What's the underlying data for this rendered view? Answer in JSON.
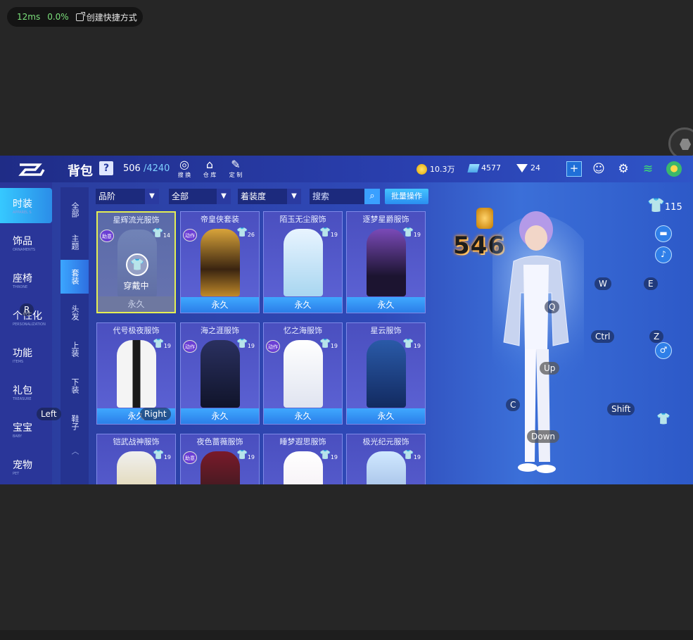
{
  "perf": {
    "latency": "12ms",
    "loss": "0.0%",
    "shortcut": "创建快捷方式"
  },
  "header": {
    "title": "背包",
    "help": "?",
    "capacity_used": "506",
    "capacity_max": "/4240",
    "icons": [
      {
        "label": "搜 换",
        "icon": "search-swap-icon"
      },
      {
        "label": "仓 库",
        "icon": "warehouse-icon"
      },
      {
        "label": "定 制",
        "icon": "custom-icon"
      }
    ],
    "coins": "10.3万",
    "tickets": "4577",
    "diamonds": "24"
  },
  "leftnav": [
    {
      "cn": "时装",
      "en": "APPAREL S"
    },
    {
      "cn": "饰品",
      "en": "ORNAMENTS"
    },
    {
      "cn": "座椅",
      "en": "THRONE"
    },
    {
      "cn": "个性化",
      "en": "PERSONALIZATION"
    },
    {
      "cn": "功能",
      "en": "ITEMS"
    },
    {
      "cn": "礼包",
      "en": "TREASURE"
    },
    {
      "cn": "宝宝",
      "en": "BABY"
    },
    {
      "cn": "宠物",
      "en": "PET"
    }
  ],
  "subnav": [
    "全部",
    "主题",
    "套装",
    "头发",
    "上装",
    "下装",
    "鞋子"
  ],
  "filters": {
    "quality": "品阶",
    "all": "全部",
    "sort": "着装度",
    "search_placeholder": "搜索",
    "batch": "批量操作"
  },
  "cards": [
    {
      "name": "星辉流光服饰",
      "lvl": "14",
      "tag": "助意",
      "foot": "永久",
      "status": "穿戴中"
    },
    {
      "name": "帝皇侠套装",
      "lvl": "26",
      "tag": "动作",
      "foot": "永久"
    },
    {
      "name": "陌玉无尘服饰",
      "lvl": "19",
      "tag": "",
      "foot": "永久"
    },
    {
      "name": "逐梦星爵服饰",
      "lvl": "19",
      "tag": "",
      "foot": "永久"
    },
    {
      "name": "代号极夜服饰",
      "lvl": "19",
      "tag": "",
      "foot": "永久"
    },
    {
      "name": "海之涯服饰",
      "lvl": "19",
      "tag": "动作",
      "foot": "永久"
    },
    {
      "name": "忆之海服饰",
      "lvl": "19",
      "tag": "动作",
      "foot": "永久"
    },
    {
      "name": "星云服饰",
      "lvl": "19",
      "tag": "",
      "foot": "永久"
    },
    {
      "name": "铠武战神服饰",
      "lvl": "19",
      "tag": "",
      "foot": ""
    },
    {
      "name": "夜色蔷薇服饰",
      "lvl": "19",
      "tag": "助意",
      "foot": ""
    },
    {
      "name": "睡梦遐思服饰",
      "lvl": "19",
      "tag": "",
      "foot": ""
    },
    {
      "name": "极光纪元服饰",
      "lvl": "19",
      "tag": "",
      "foot": ""
    }
  ],
  "character": {
    "power": "546",
    "outfit_count": "115"
  },
  "keys": [
    "R",
    "Left",
    "Right",
    "W",
    "E",
    "Q",
    "Ctrl",
    "Z",
    "Up",
    "C",
    "Shift",
    "Down"
  ],
  "colors": {
    "accent": "#36c9ff",
    "selected": "#e5ef52",
    "panel": "#2f49b8"
  }
}
